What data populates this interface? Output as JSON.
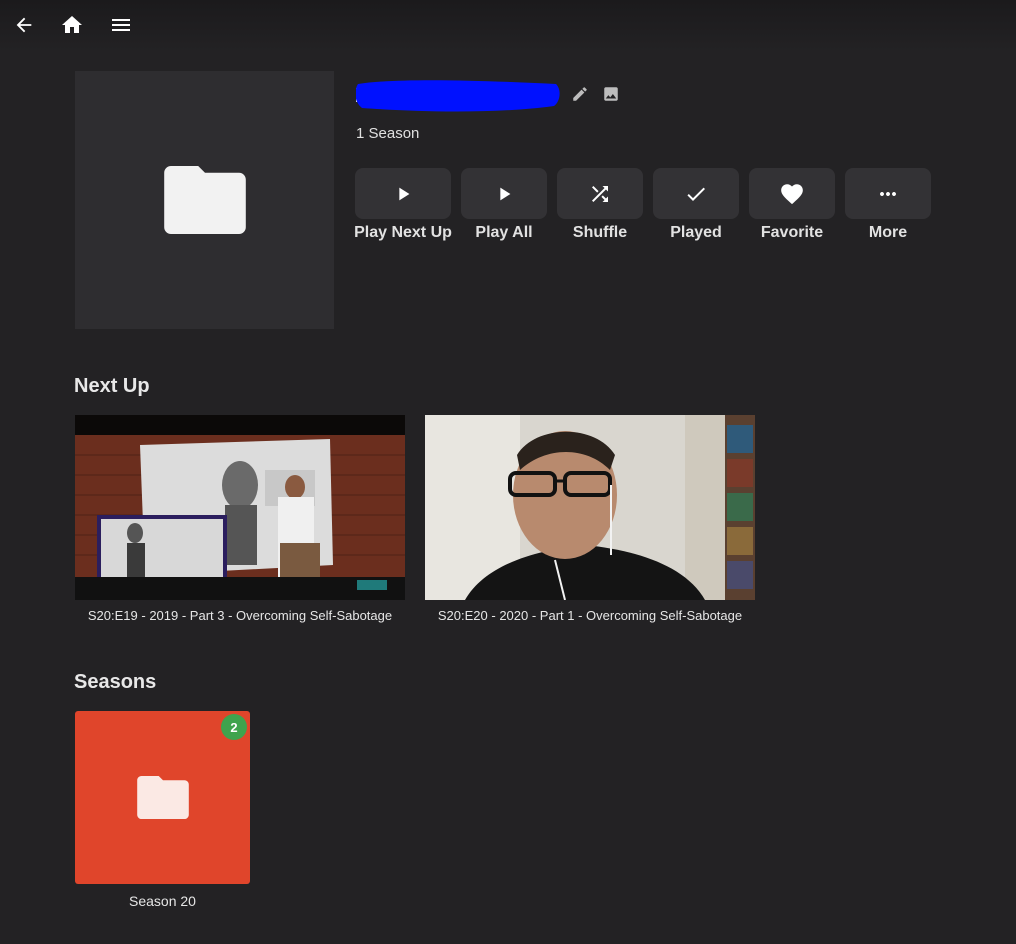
{
  "header": {
    "icons": [
      "arrow-back-icon",
      "home-icon",
      "menu-icon"
    ]
  },
  "series": {
    "subtitle": "1 Season",
    "title_redaction_color": "#0011ff"
  },
  "actions": [
    {
      "label": "Play Next Up",
      "icon": "play-icon"
    },
    {
      "label": "Play All",
      "icon": "play-icon"
    },
    {
      "label": "Shuffle",
      "icon": "shuffle-icon"
    },
    {
      "label": "Played",
      "icon": "check-icon"
    },
    {
      "label": "Favorite",
      "icon": "heart-icon"
    },
    {
      "label": "More",
      "icon": "more-horiz-icon"
    }
  ],
  "next_up": {
    "heading": "Next Up",
    "items": [
      {
        "title": "S20:E19 - 2019 - Part 3 - Overcoming Self-Sabotage"
      },
      {
        "title": "S20:E20 - 2020 - Part 1 - Overcoming Self-Sabotage"
      }
    ]
  },
  "seasons": {
    "heading": "Seasons",
    "items": [
      {
        "name": "Season 20",
        "unplayed_count": "2",
        "color": "#e0452b"
      }
    ]
  },
  "colors": {
    "background": "#232224",
    "button": "#333235",
    "badge": "#3fa34d"
  }
}
